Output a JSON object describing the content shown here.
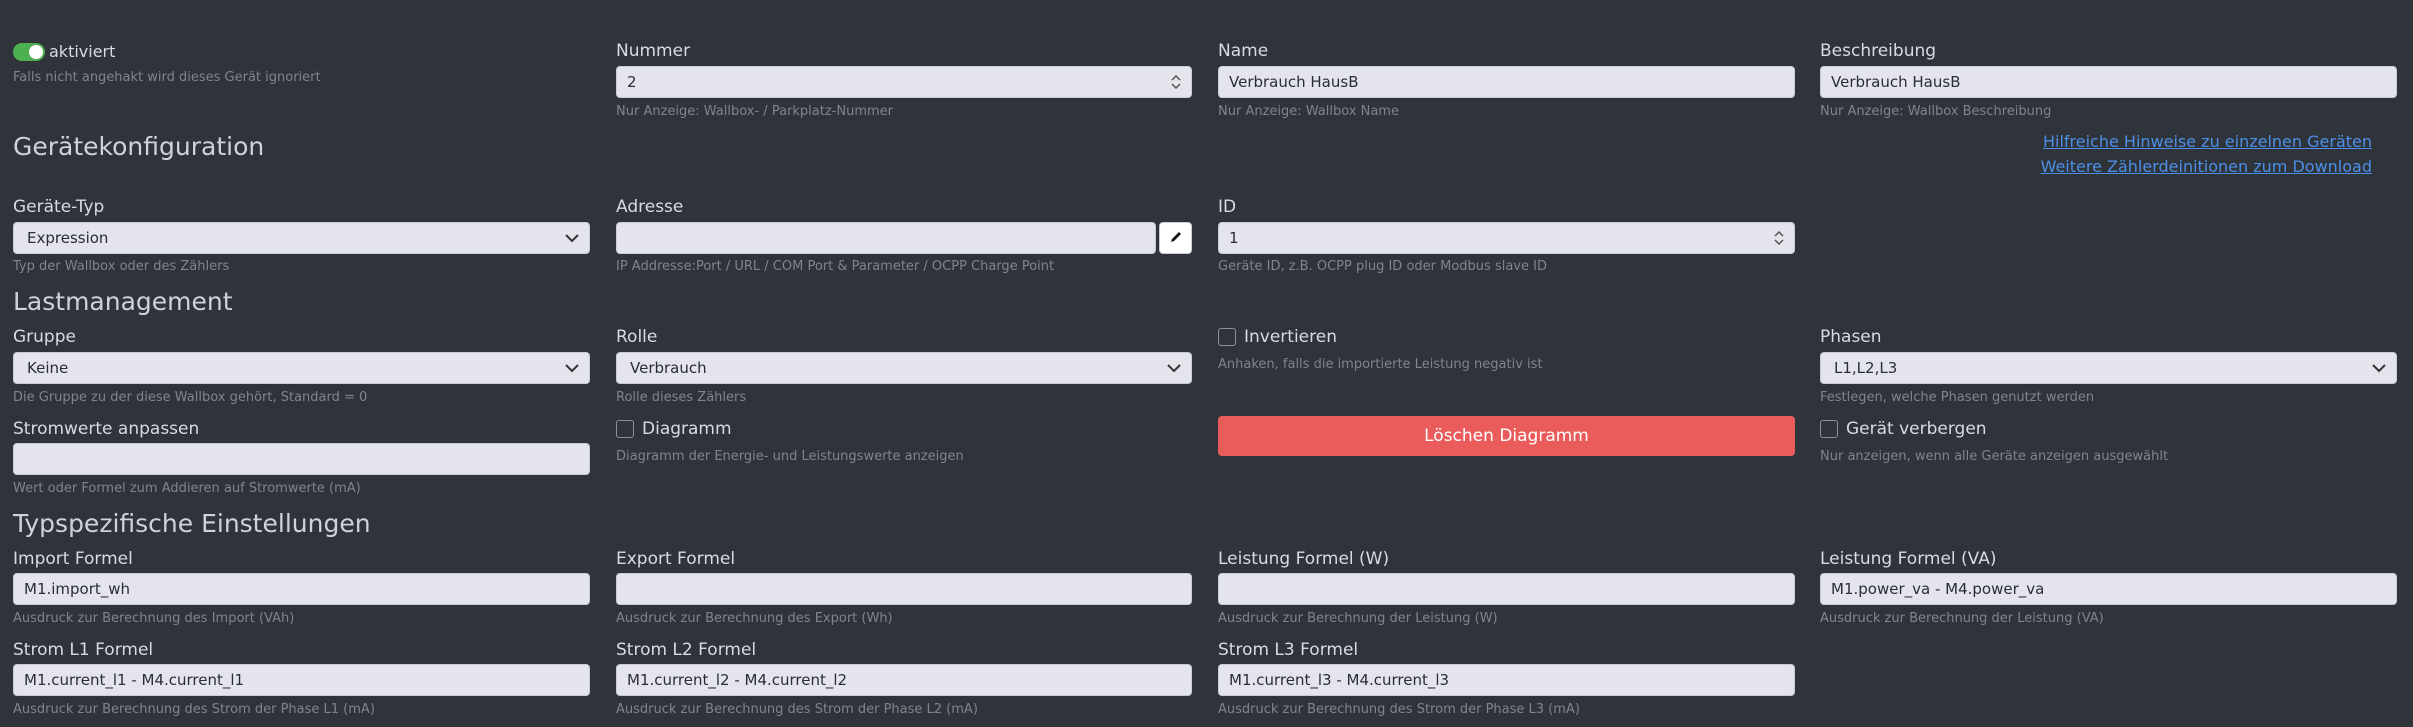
{
  "top": {
    "enabled": {
      "label": "aktiviert",
      "hint": "Falls nicht angehakt wird dieses Gerät ignoriert"
    },
    "nummer": {
      "label": "Nummer",
      "value": "2",
      "hint": "Nur Anzeige: Wallbox- / Parkplatz-Nummer"
    },
    "name": {
      "label": "Name",
      "value": "Verbrauch HausB",
      "hint": "Nur Anzeige: Wallbox Name"
    },
    "beschreibung": {
      "label": "Beschreibung",
      "value": "Verbrauch HausB",
      "hint": "Nur Anzeige: Wallbox Beschreibung"
    }
  },
  "geraetekonfiguration": {
    "title": "Gerätekonfiguration",
    "links": [
      "Hilfreiche Hinweise zu einzelnen Geräten",
      "Weitere Zählerdeinitionen zum Download"
    ],
    "typ": {
      "label": "Geräte-Typ",
      "value": "Expression",
      "hint": "Typ der Wallbox oder des Zählers"
    },
    "adresse": {
      "label": "Adresse",
      "value": "",
      "hint": "IP Addresse:Port / URL / COM Port & Parameter / OCPP Charge Point"
    },
    "id": {
      "label": "ID",
      "value": "1",
      "hint": "Geräte ID, z.B. OCPP plug ID oder Modbus slave ID"
    }
  },
  "lastmanagement": {
    "title": "Lastmanagement",
    "gruppe": {
      "label": "Gruppe",
      "value": "Keine",
      "hint": "Die Gruppe zu der diese Wallbox gehört, Standard = 0"
    },
    "rolle": {
      "label": "Rolle",
      "value": "Verbrauch",
      "hint": "Rolle dieses Zählers"
    },
    "invertieren": {
      "label": "Invertieren",
      "hint": "Anhaken, falls die importierte Leistung negativ ist"
    },
    "phasen": {
      "label": "Phasen",
      "value": "L1,L2,L3",
      "hint": "Festlegen, welche Phasen genutzt werden"
    },
    "stromwerte": {
      "label": "Stromwerte anpassen",
      "value": "",
      "hint": "Wert oder Formel zum Addieren auf Stromwerte (mA)"
    },
    "diagramm": {
      "label": "Diagramm",
      "hint": "Diagramm der Energie- und Leistungswerte anzeigen"
    },
    "loeschen": {
      "label": "Löschen Diagramm"
    },
    "verbergen": {
      "label": "Gerät verbergen",
      "hint": "Nur anzeigen, wenn alle Geräte anzeigen ausgewählt"
    }
  },
  "typspezifisch": {
    "title": "Typspezifische Einstellungen",
    "import": {
      "label": "Import Formel",
      "value": "M1.import_wh",
      "hint": "Ausdruck zur Berechnung des Import (VAh)"
    },
    "export": {
      "label": "Export Formel",
      "value": "",
      "hint": "Ausdruck zur Berechnung des Export (Wh)"
    },
    "leistung_w": {
      "label": "Leistung Formel (W)",
      "value": "",
      "hint": "Ausdruck zur Berechnung der Leistung (W)"
    },
    "leistung_va": {
      "label": "Leistung Formel (VA)",
      "value": "M1.power_va - M4.power_va",
      "hint": "Ausdruck zur Berechnung der Leistung (VA)"
    },
    "strom_l1": {
      "label": "Strom L1 Formel",
      "value": "M1.current_l1 - M4.current_l1",
      "hint": "Ausdruck zur Berechnung des Strom der Phase L1 (mA)"
    },
    "strom_l2": {
      "label": "Strom L2 Formel",
      "value": "M1.current_l2 - M4.current_l2",
      "hint": "Ausdruck zur Berechnung des Strom der Phase L2 (mA)"
    },
    "strom_l3": {
      "label": "Strom L3 Formel",
      "value": "M1.current_l3 - M4.current_l3",
      "hint": "Ausdruck zur Berechnung des Strom der Phase L3 (mA)"
    }
  },
  "colors": {
    "accent_toggle": "#4caf50",
    "danger": "#ea5b5b",
    "link": "#4d8fe6",
    "background": "#2f333a"
  },
  "icons": {
    "select": "chevron-down-icon",
    "spinner": "spinner-arrows-icon",
    "address": "pencil-icon"
  }
}
